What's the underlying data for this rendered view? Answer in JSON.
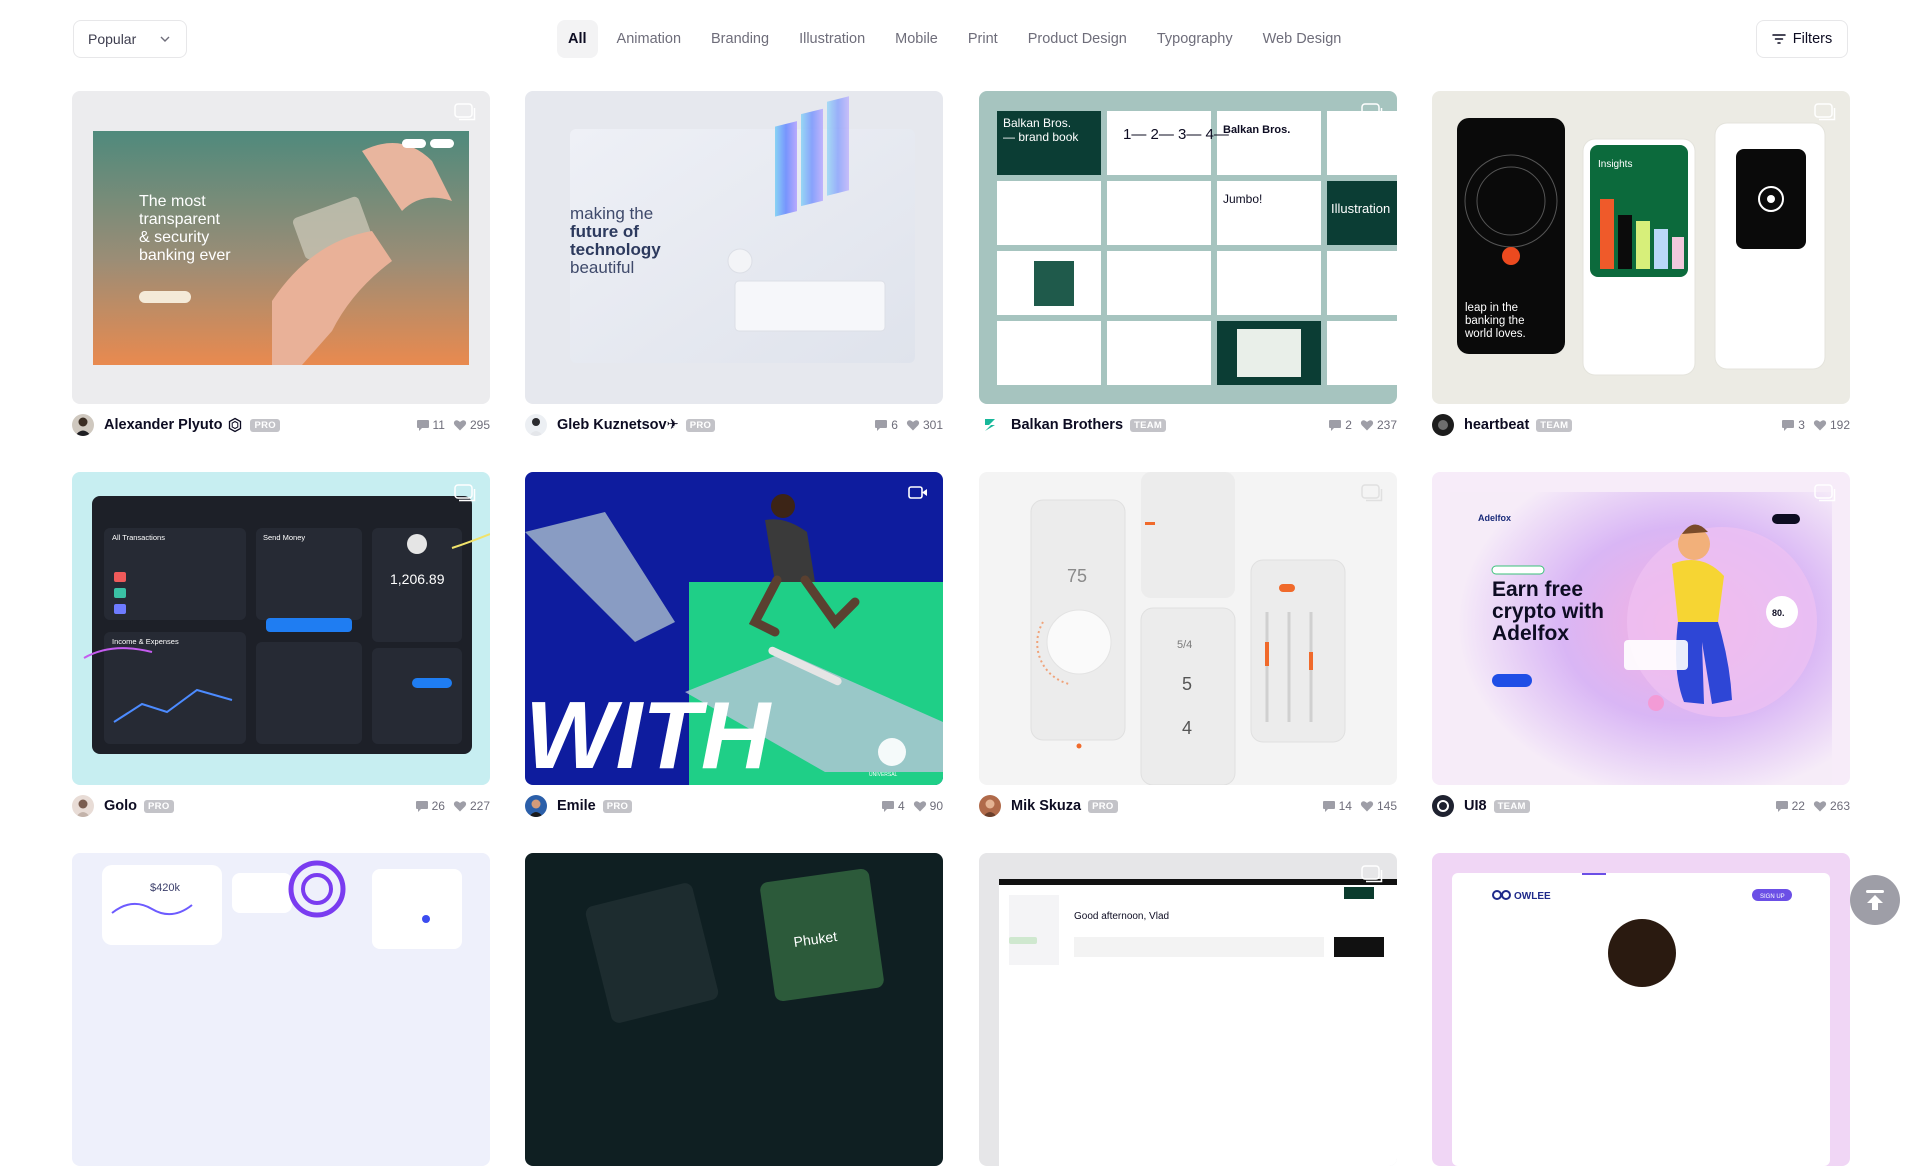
{
  "toolbar": {
    "sort_value": "Popular",
    "filters_label": "Filters",
    "categories": [
      "All",
      "Animation",
      "Branding",
      "Illustration",
      "Mobile",
      "Print",
      "Product Design",
      "Typography",
      "Web Design"
    ]
  },
  "shots": [
    {
      "author": "Alexander Plyuto",
      "badge": "PRO",
      "comments": "11",
      "likes": "295",
      "art_text": [
        "The most",
        "transparent",
        "& security",
        "banking ever"
      ]
    },
    {
      "author": "Gleb Kuznetsov✈",
      "badge": "PRO",
      "comments": "6",
      "likes": "301",
      "art_text": [
        "making the",
        "future of",
        "technology",
        "beautiful"
      ]
    },
    {
      "author": "Balkan Brothers",
      "badge": "TEAM",
      "comments": "2",
      "likes": "237",
      "art_text": [
        "Balkan Bros.",
        "— brand book",
        "Jumbo!",
        "Illustration"
      ]
    },
    {
      "author": "heartbeat",
      "badge": "TEAM",
      "comments": "3",
      "likes": "192",
      "art_text": [
        "leap in the",
        "banking the",
        "world loves.",
        "Insights"
      ]
    },
    {
      "author": "Golo",
      "badge": "PRO",
      "comments": "26",
      "likes": "227",
      "art_text": [
        "All Transactions",
        "Send Money",
        "1,206.89",
        "Income & Expenses"
      ]
    },
    {
      "author": "Emile",
      "badge": "PRO",
      "comments": "4",
      "likes": "90",
      "art_text": [
        "WITH",
        "UNIVERSAL"
      ]
    },
    {
      "author": "Mik Skuza",
      "badge": "PRO",
      "comments": "14",
      "likes": "145",
      "art_text": [
        "75",
        "5/4",
        "5",
        "4"
      ]
    },
    {
      "author": "UI8",
      "badge": "TEAM",
      "comments": "22",
      "likes": "263",
      "art_text": [
        "Earn free",
        "crypto with",
        "Adelfox",
        "Adelfox",
        "80."
      ]
    },
    {
      "author": "",
      "badge": "",
      "comments": "",
      "likes": "",
      "art_text": [
        "$420k"
      ]
    },
    {
      "author": "",
      "badge": "",
      "comments": "",
      "likes": "",
      "art_text": [
        "Phuket"
      ]
    },
    {
      "author": "",
      "badge": "",
      "comments": "",
      "likes": "",
      "art_text": [
        "Good afternoon, Vlad"
      ]
    },
    {
      "author": "",
      "badge": "",
      "comments": "",
      "likes": "",
      "art_text": [
        "OWLEE",
        "SIGN UP"
      ]
    }
  ],
  "colors": {
    "text": "#0d0c22",
    "muted": "#6e6d7a",
    "border": "#e7e7e9",
    "badge": "#c3c3c8",
    "active_tab_bg": "#f3f3f4"
  }
}
